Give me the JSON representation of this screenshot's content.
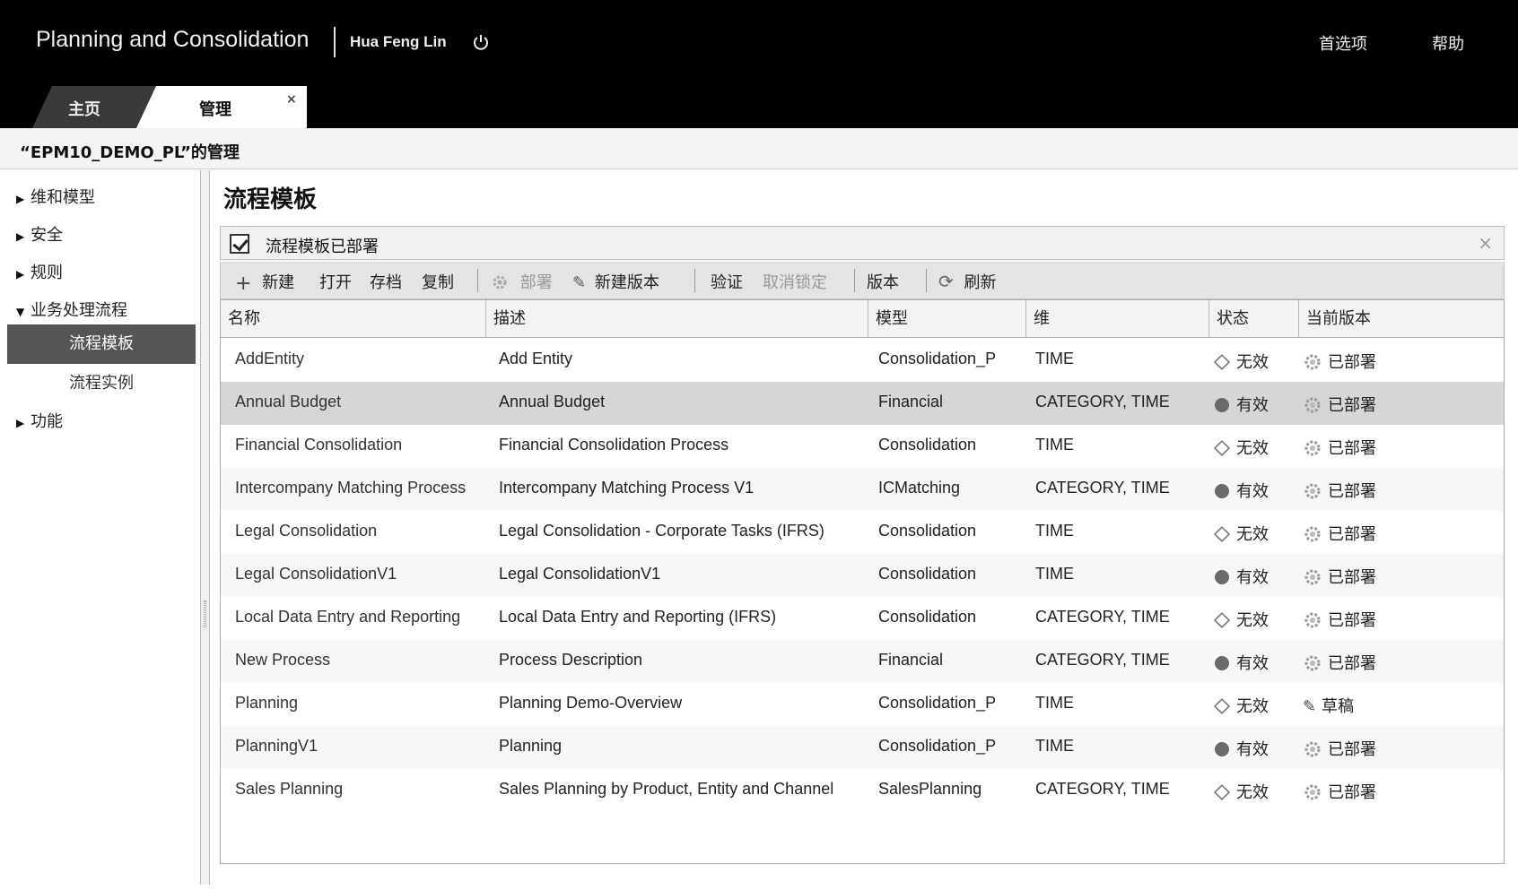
{
  "header": {
    "app_title": "Planning and Consolidation",
    "user": "Hua Feng Lin",
    "preferences": "首选项",
    "help": "帮助"
  },
  "tabs": [
    {
      "label": "主页"
    },
    {
      "label": "管理",
      "close": "×"
    }
  ],
  "breadcrumb": "“EPM10_DEMO_PL”的管理",
  "sidebar": {
    "items": [
      {
        "label": "维和模型"
      },
      {
        "label": "安全"
      },
      {
        "label": "规则"
      },
      {
        "label": "业务处理流程"
      },
      {
        "label": "流程模板"
      },
      {
        "label": "流程实例"
      },
      {
        "label": "功能"
      }
    ]
  },
  "main": {
    "title": "流程模板",
    "message": "流程模板已部署",
    "message_close": "×",
    "toolbar": {
      "new": "新建",
      "open": "打开",
      "save": "存档",
      "copy": "复制",
      "deploy": "部署",
      "new_version": "新建版本",
      "validate": "验证",
      "unlock": "取消锁定",
      "version": "版本",
      "refresh": "刷新"
    },
    "columns": [
      "名称",
      "描述",
      "模型",
      "维",
      "状态",
      "当前版本"
    ],
    "rows": [
      {
        "name": "AddEntity",
        "desc": "Add Entity",
        "model": "Consolidation_P",
        "dims": "TIME",
        "state": "无效",
        "state_icon": "invalid-diamond",
        "version": "已部署",
        "version_icon": "gear"
      },
      {
        "name": "Annual Budget",
        "desc": "Annual Budget",
        "model": "Financial",
        "dims": "CATEGORY, TIME",
        "state": "有效",
        "state_icon": "valid-dot",
        "version": "已部署",
        "version_icon": "gear"
      },
      {
        "name": "Financial Consolidation",
        "desc": "Financial Consolidation Process",
        "model": "Consolidation",
        "dims": "TIME",
        "state": "无效",
        "state_icon": "invalid-diamond",
        "version": "已部署",
        "version_icon": "gear"
      },
      {
        "name": "Intercompany Matching Process",
        "desc": "Intercompany Matching Process V1",
        "model": "ICMatching",
        "dims": "CATEGORY, TIME",
        "state": "有效",
        "state_icon": "valid-dot",
        "version": "已部署",
        "version_icon": "gear"
      },
      {
        "name": "Legal Consolidation",
        "desc": "Legal Consolidation - Corporate Tasks (IFRS)",
        "model": "Consolidation",
        "dims": "TIME",
        "state": "无效",
        "state_icon": "invalid-diamond",
        "version": "已部署",
        "version_icon": "gear"
      },
      {
        "name": "Legal ConsolidationV1",
        "desc": "Legal ConsolidationV1",
        "model": "Consolidation",
        "dims": "TIME",
        "state": "有效",
        "state_icon": "valid-dot",
        "version": "已部署",
        "version_icon": "gear"
      },
      {
        "name": "Local Data Entry and Reporting",
        "desc": "Local Data Entry and Reporting (IFRS)",
        "model": "Consolidation",
        "dims": "CATEGORY, TIME",
        "state": "无效",
        "state_icon": "invalid-diamond",
        "version": "已部署",
        "version_icon": "gear"
      },
      {
        "name": "New Process",
        "desc": "Process Description",
        "model": "Financial",
        "dims": "CATEGORY, TIME",
        "state": "有效",
        "state_icon": "valid-dot",
        "version": "已部署",
        "version_icon": "gear"
      },
      {
        "name": "Planning",
        "desc": "Planning Demo-Overview",
        "model": "Consolidation_P",
        "dims": "TIME",
        "state": "无效",
        "state_icon": "invalid-diamond",
        "version": "草稿",
        "version_icon": "pencil"
      },
      {
        "name": "PlanningV1",
        "desc": "Planning",
        "model": "Consolidation_P",
        "dims": "TIME",
        "state": "有效",
        "state_icon": "valid-dot",
        "version": "已部署",
        "version_icon": "gear"
      },
      {
        "name": "Sales Planning",
        "desc": "Sales Planning by Product, Entity and Channel",
        "model": "SalesPlanning",
        "dims": "CATEGORY, TIME",
        "state": "无效",
        "state_icon": "invalid-diamond",
        "version": "已部署",
        "version_icon": "gear"
      }
    ]
  }
}
